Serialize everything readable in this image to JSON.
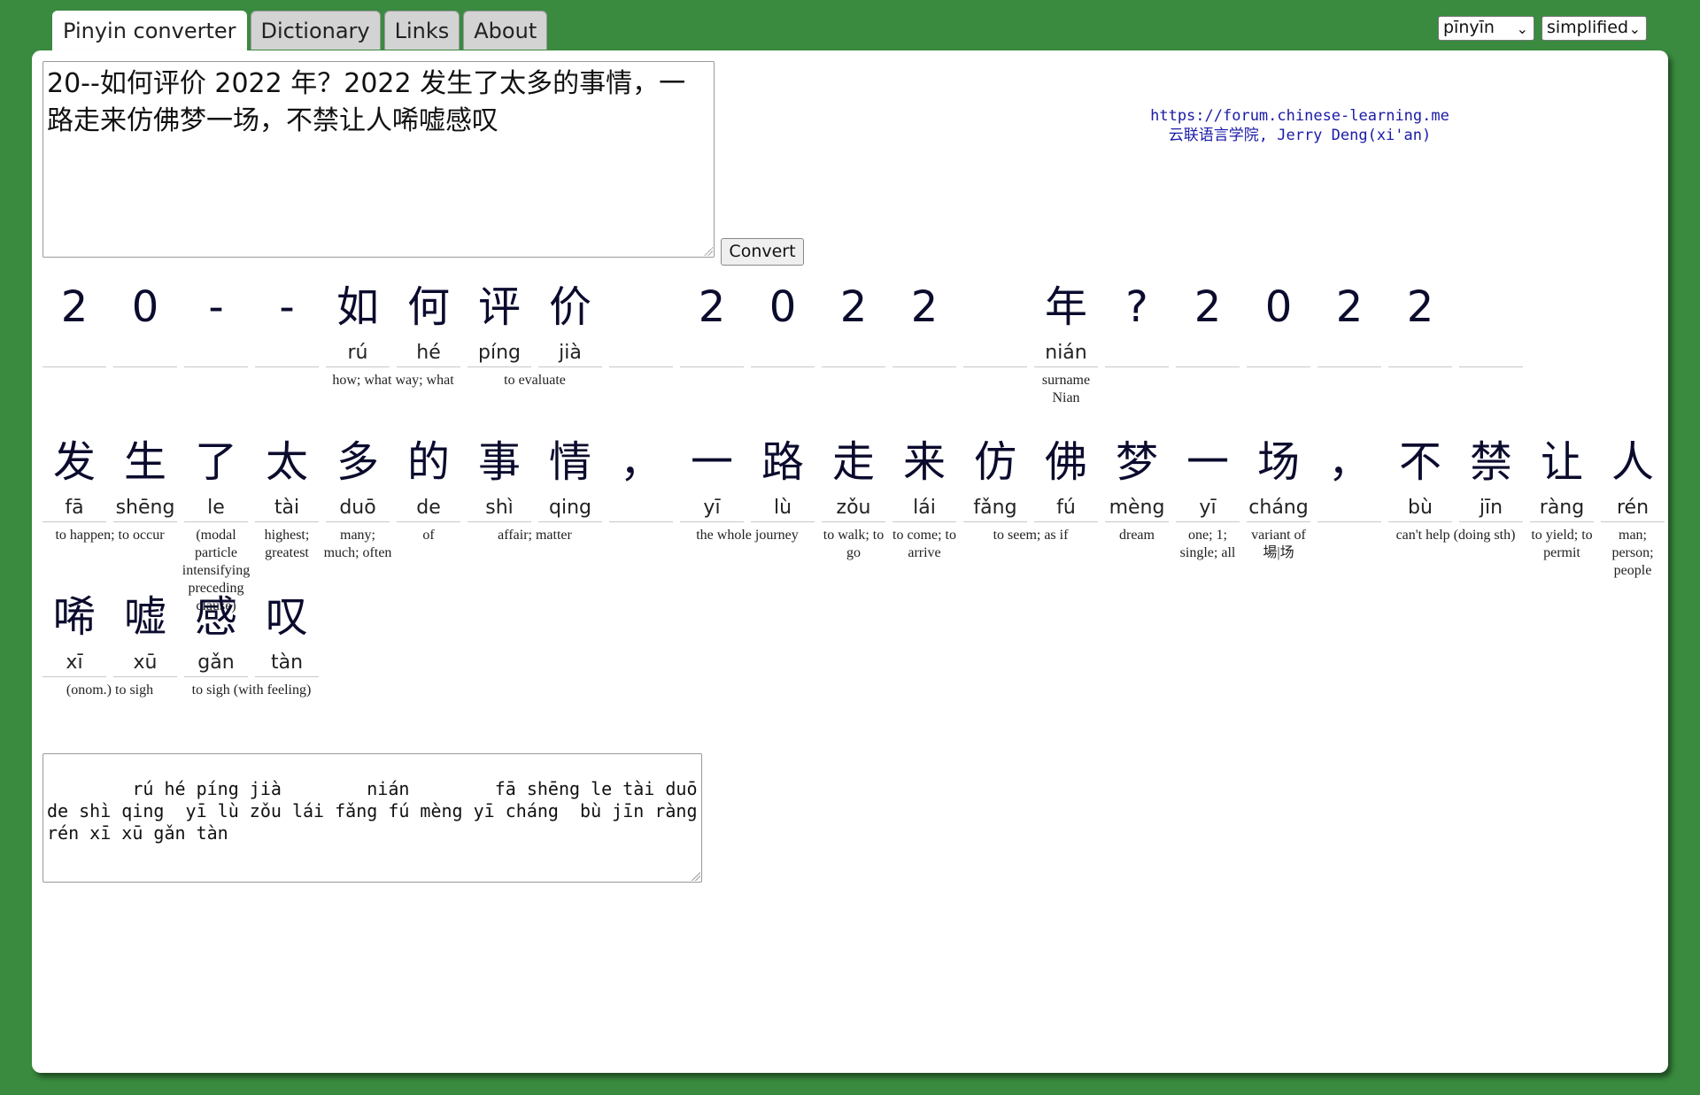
{
  "tabs": [
    {
      "label": "Pinyin converter",
      "active": true
    },
    {
      "label": "Dictionary",
      "active": false
    },
    {
      "label": "Links",
      "active": false
    },
    {
      "label": "About",
      "active": false
    }
  ],
  "selects": {
    "romanization": "pīnyīn",
    "script": "simplified"
  },
  "input": {
    "value": "20--如何评价 2022 年？2022 发生了太多的事情，一路走来仿佛梦一场，不禁让人唏嘘感叹"
  },
  "convert_label": "Convert",
  "credit": {
    "url": "https://forum.chinese-learning.me",
    "author": "云联语言学院, Jerry Deng(xi'an)"
  },
  "rows": [
    [
      {
        "hz": "2",
        "py": "",
        "def": ""
      },
      {
        "hz": "0",
        "py": "",
        "def": ""
      },
      {
        "hz": "-",
        "py": "",
        "def": ""
      },
      {
        "hz": "-",
        "py": "",
        "def": ""
      },
      {
        "hz": "如",
        "py": "rú",
        "def": "how; what way; what"
      },
      {
        "hz": "何",
        "py": "hé",
        "def": ""
      },
      {
        "hz": "评",
        "py": "píng",
        "def": "to evaluate"
      },
      {
        "hz": "价",
        "py": "jià",
        "def": ""
      },
      {
        "hz": "",
        "py": "",
        "def": ""
      },
      {
        "hz": "2",
        "py": "",
        "def": ""
      },
      {
        "hz": "0",
        "py": "",
        "def": ""
      },
      {
        "hz": "2",
        "py": "",
        "def": ""
      },
      {
        "hz": "2",
        "py": "",
        "def": ""
      },
      {
        "hz": "",
        "py": "",
        "def": ""
      },
      {
        "hz": "年",
        "py": "nián",
        "def": "surname Nian"
      },
      {
        "hz": "?",
        "py": "",
        "def": ""
      },
      {
        "hz": "2",
        "py": "",
        "def": ""
      },
      {
        "hz": "0",
        "py": "",
        "def": ""
      },
      {
        "hz": "2",
        "py": "",
        "def": ""
      },
      {
        "hz": "2",
        "py": "",
        "def": ""
      },
      {
        "hz": "",
        "py": "",
        "def": ""
      }
    ],
    [
      {
        "hz": "发",
        "py": "fā",
        "def": "to happen; to occur"
      },
      {
        "hz": "生",
        "py": "shēng",
        "def": ""
      },
      {
        "hz": "了",
        "py": "le",
        "def": "(modal particle intensifying preceding clause)"
      },
      {
        "hz": "太",
        "py": "tài",
        "def": "highest; greatest"
      },
      {
        "hz": "多",
        "py": "duō",
        "def": "many; much; often"
      },
      {
        "hz": "的",
        "py": "de",
        "def": "of"
      },
      {
        "hz": "事",
        "py": "shì",
        "def": "affair; matter"
      },
      {
        "hz": "情",
        "py": "qing",
        "def": ""
      },
      {
        "hz": "，",
        "py": "",
        "def": ""
      },
      {
        "hz": "一",
        "py": "yī",
        "def": "the whole journey"
      },
      {
        "hz": "路",
        "py": "lù",
        "def": ""
      },
      {
        "hz": "走",
        "py": "zǒu",
        "def": "to walk; to go"
      },
      {
        "hz": "来",
        "py": "lái",
        "def": "to come; to arrive"
      },
      {
        "hz": "仿",
        "py": "fǎng",
        "def": "to seem; as if"
      },
      {
        "hz": "佛",
        "py": "fú",
        "def": ""
      },
      {
        "hz": "梦",
        "py": "mèng",
        "def": "dream"
      },
      {
        "hz": "一",
        "py": "yī",
        "def": "one; 1; single; all"
      },
      {
        "hz": "场",
        "py": "cháng",
        "def": "variant of 場|场"
      },
      {
        "hz": "，",
        "py": "",
        "def": ""
      },
      {
        "hz": "不",
        "py": "bù",
        "def": "can't help (doing sth)"
      },
      {
        "hz": "禁",
        "py": "jīn",
        "def": ""
      },
      {
        "hz": "让",
        "py": "ràng",
        "def": "to yield; to permit"
      },
      {
        "hz": "人",
        "py": "rén",
        "def": "man; person; people"
      }
    ],
    [
      {
        "hz": "唏",
        "py": "xī",
        "def": "(onom.) to sigh"
      },
      {
        "hz": "嘘",
        "py": "xū",
        "def": ""
      },
      {
        "hz": "感",
        "py": "gǎn",
        "def": "to sigh (with feeling)"
      },
      {
        "hz": "叹",
        "py": "tàn",
        "def": ""
      }
    ]
  ],
  "output": {
    "value": "    rú hé píng jià        nián        fā shēng le tài duō de shì qing  yī lù zǒu lái fǎng fú mèng yī cháng  bù jīn ràng rén xī xū gǎn tàn"
  }
}
